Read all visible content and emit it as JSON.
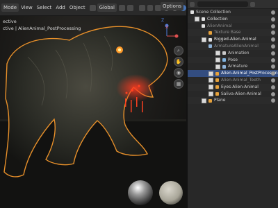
{
  "viewport": {
    "mode_label": "Mode",
    "menu": [
      "View",
      "Select",
      "Add",
      "Object"
    ],
    "orientation_label": "Global",
    "options_label": "Options",
    "info_line1": "ective",
    "info_line2": "ctive | AlienAnimal_PostProcessing",
    "gizmo_x": "X",
    "gizmo_z": "Z"
  },
  "outliner": {
    "search_placeholder": "",
    "rows": [
      {
        "label": "Scene Collection",
        "indent": 4,
        "icon": "collection",
        "color": "#d0d0d0"
      },
      {
        "label": "Collection",
        "indent": 10,
        "icon": "collection",
        "color": "#e0e0e0"
      },
      {
        "label": "AlienAnimal",
        "indent": 20,
        "icon": "collection",
        "color": "#8a8a8a",
        "dim": true
      },
      {
        "label": "Texture Base",
        "indent": 30,
        "icon": "mesh",
        "color": "#8a8a8a",
        "dim": true
      },
      {
        "label": "Rigged-Alien-Animal",
        "indent": 20,
        "icon": "collection",
        "color": "#e0e0e0"
      },
      {
        "label": "ArmatureAlienAnimal",
        "indent": 30,
        "icon": "armature",
        "color": "#8a8a8a",
        "dim": true
      },
      {
        "label": "Animation",
        "indent": 40,
        "icon": "action",
        "color": "#d0d0d0"
      },
      {
        "label": "Pose",
        "indent": 40,
        "icon": "pose",
        "color": "#d0d0d0"
      },
      {
        "label": "Armature",
        "indent": 40,
        "icon": "armature",
        "color": "#d0d0d0"
      },
      {
        "label": "Alien-Animal_PostProcessing",
        "indent": 30,
        "icon": "mesh",
        "color": "#ffffff",
        "selected": true
      },
      {
        "label": "Alien-Animal_Teeth",
        "indent": 30,
        "icon": "mesh",
        "color": "#8a8a8a",
        "dim": true
      },
      {
        "label": "Eyes-Alien-Animal",
        "indent": 30,
        "icon": "mesh",
        "color": "#d0d0d0"
      },
      {
        "label": "Saliva-Alien-Animal",
        "indent": 30,
        "icon": "mesh",
        "color": "#d0d0d0"
      },
      {
        "label": "Plane",
        "indent": 20,
        "icon": "mesh",
        "color": "#d0d0d0"
      }
    ]
  },
  "colors": {
    "selection": "#334d80",
    "mesh_icon": "#e6a23c",
    "armature_icon": "#8fb3d9",
    "collection_icon": "#e0e0e0",
    "outline": "#e8902a",
    "glow": "#ff2a1a"
  }
}
